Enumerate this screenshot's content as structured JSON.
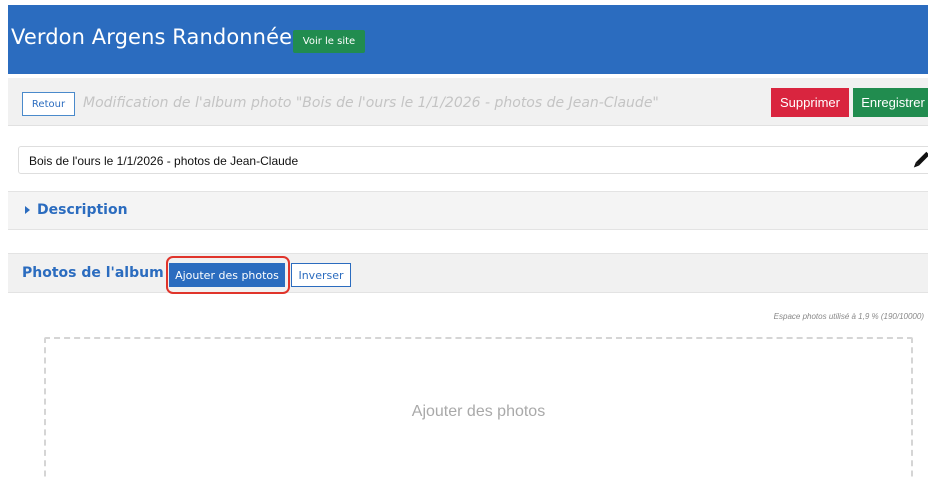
{
  "header": {
    "site_title": "Verdon Argens Randonnée",
    "visit_site_label": "Voir le site",
    "background_color": "#2b6cbf"
  },
  "action_bar": {
    "back_label": "Retour",
    "page_heading": "Modification de l'album photo \"Bois de l'ours le 1/1/2026 - photos de Jean-Claude\"",
    "delete_label": "Supprimer",
    "save_label": "Enregistrer",
    "delete_color": "#d9253f",
    "save_color": "#218c4f"
  },
  "title_field": {
    "value": "Bois de l'ours le 1/1/2026 - photos de Jean-Claude",
    "edit_icon": "pencil-icon"
  },
  "description": {
    "label": "Description",
    "expanded": false,
    "toggle_icon": "caret-right-icon"
  },
  "photos": {
    "label": "Photos de l'album",
    "add_photos_label": "Ajouter des photos",
    "invert_label": "Inverser",
    "usage_text": "Espace photos utilisé à 1,9 % (190/10000)",
    "dropzone_text": "Ajouter des photos",
    "highlight_color": "#e0342b"
  }
}
